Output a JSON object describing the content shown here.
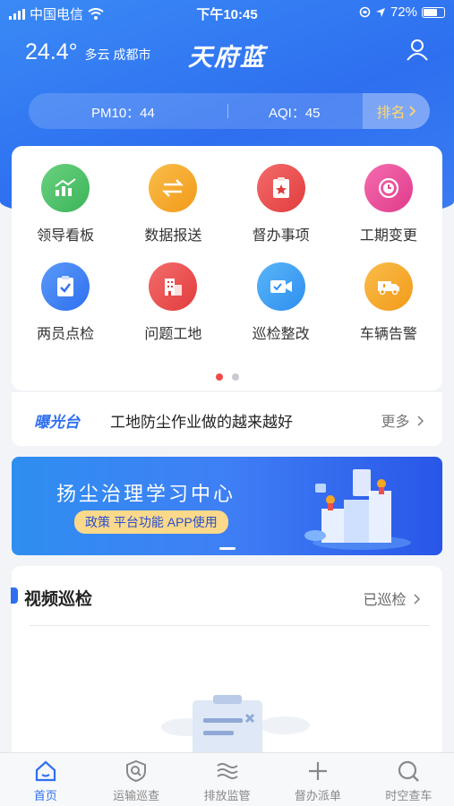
{
  "status_bar": {
    "carrier": "中国电信",
    "time": "下午10:45",
    "battery": "72%",
    "battery_level": 0.72
  },
  "header": {
    "temperature": "24.4°",
    "weather": "多云 成都市",
    "title": "天府蓝",
    "user_icon": "user-icon"
  },
  "air_quality": {
    "pm10": "PM10：44",
    "aqi": "AQI：45",
    "rank_label": "排名"
  },
  "grid": {
    "items": [
      {
        "label": "领导看板",
        "icon": "chart-icon",
        "color": "#4cc36a"
      },
      {
        "label": "数据报送",
        "icon": "exchange-icon",
        "color": "#f5a623"
      },
      {
        "label": "督办事项",
        "icon": "clipboard-star-icon",
        "color": "#ec4f4f"
      },
      {
        "label": "工期变更",
        "icon": "clock-icon",
        "color": "#ee4b9a"
      },
      {
        "label": "两员点检",
        "icon": "clipboard-check-icon",
        "color": "#3d82f0"
      },
      {
        "label": "问题工地",
        "icon": "building-icon",
        "color": "#ec4f4f"
      },
      {
        "label": "巡检整改",
        "icon": "video-camera-icon",
        "color": "#3aa0f0"
      },
      {
        "label": "车辆告警",
        "icon": "truck-icon",
        "color": "#f5a623"
      }
    ],
    "page_count": 2,
    "active_page": 1
  },
  "news": {
    "brand": "曝光台",
    "text": "工地防尘作业做的越来越好",
    "more": "更多"
  },
  "banner": {
    "title": "扬尘治理学习中心",
    "tags": "政策  平台功能  APP使用"
  },
  "video": {
    "title": "视频巡检",
    "link": "已巡检"
  },
  "tabbar": {
    "items": [
      {
        "label": "首页",
        "icon": "home-icon",
        "active": true
      },
      {
        "label": "运输巡查",
        "icon": "shield-search-icon",
        "active": false
      },
      {
        "label": "排放监管",
        "icon": "waves-icon",
        "active": false
      },
      {
        "label": "督办派单",
        "icon": "plus-icon",
        "active": false
      },
      {
        "label": "时空查车",
        "icon": "search-icon",
        "active": false
      }
    ]
  },
  "colors": {
    "brand": "#2f6ff0",
    "rank": "#ffd86b",
    "dot_active": "#ef4b4b"
  }
}
